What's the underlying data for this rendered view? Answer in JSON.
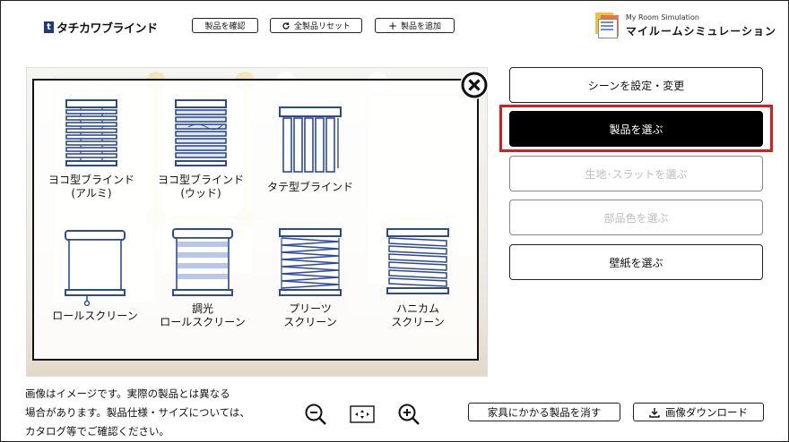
{
  "header": {
    "logo_text": "タチカワブラインド",
    "buttons": {
      "confirm": "製品を確認",
      "reset": "全製品リセット",
      "add": "製品を追加"
    },
    "brand_sub": "My Room Simulation",
    "brand_title": "マイルームシミュレーション"
  },
  "product_menu": {
    "items": [
      {
        "line1": "ヨコ型ブラインド",
        "line2": "(アルミ)"
      },
      {
        "line1": "ヨコ型ブラインド",
        "line2": "(ウッド)"
      },
      {
        "line1": "タテ型ブラインド",
        "line2": ""
      },
      {
        "line1": "ロールスクリーン",
        "line2": ""
      },
      {
        "line1": "調光",
        "line2": "ロールスクリーン"
      },
      {
        "line1": "プリーツ",
        "line2": "スクリーン"
      },
      {
        "line1": "ハニカム",
        "line2": "スクリーン"
      }
    ]
  },
  "sidebar": {
    "scene": "シーンを設定・変更",
    "choose_product": "製品を選ぶ",
    "choose_fabric": "生地･スラットを選ぶ",
    "choose_part_color": "部品色を選ぶ",
    "choose_wallpaper": "壁紙を選ぶ"
  },
  "footer": {
    "note_lines": [
      "画像はイメージです。実際の製品とは異なる",
      "場合があります。製品仕様・サイズについては、",
      "カタログ等でご確認ください。"
    ],
    "remove_furniture": "家具にかかる製品を消す",
    "download": "画像ダウンロード"
  },
  "colors": {
    "accent": "#000000",
    "highlight": "#d71e1e",
    "blind_blue": "#2d4a9a",
    "handle_yellow": "#f3e2b0"
  }
}
